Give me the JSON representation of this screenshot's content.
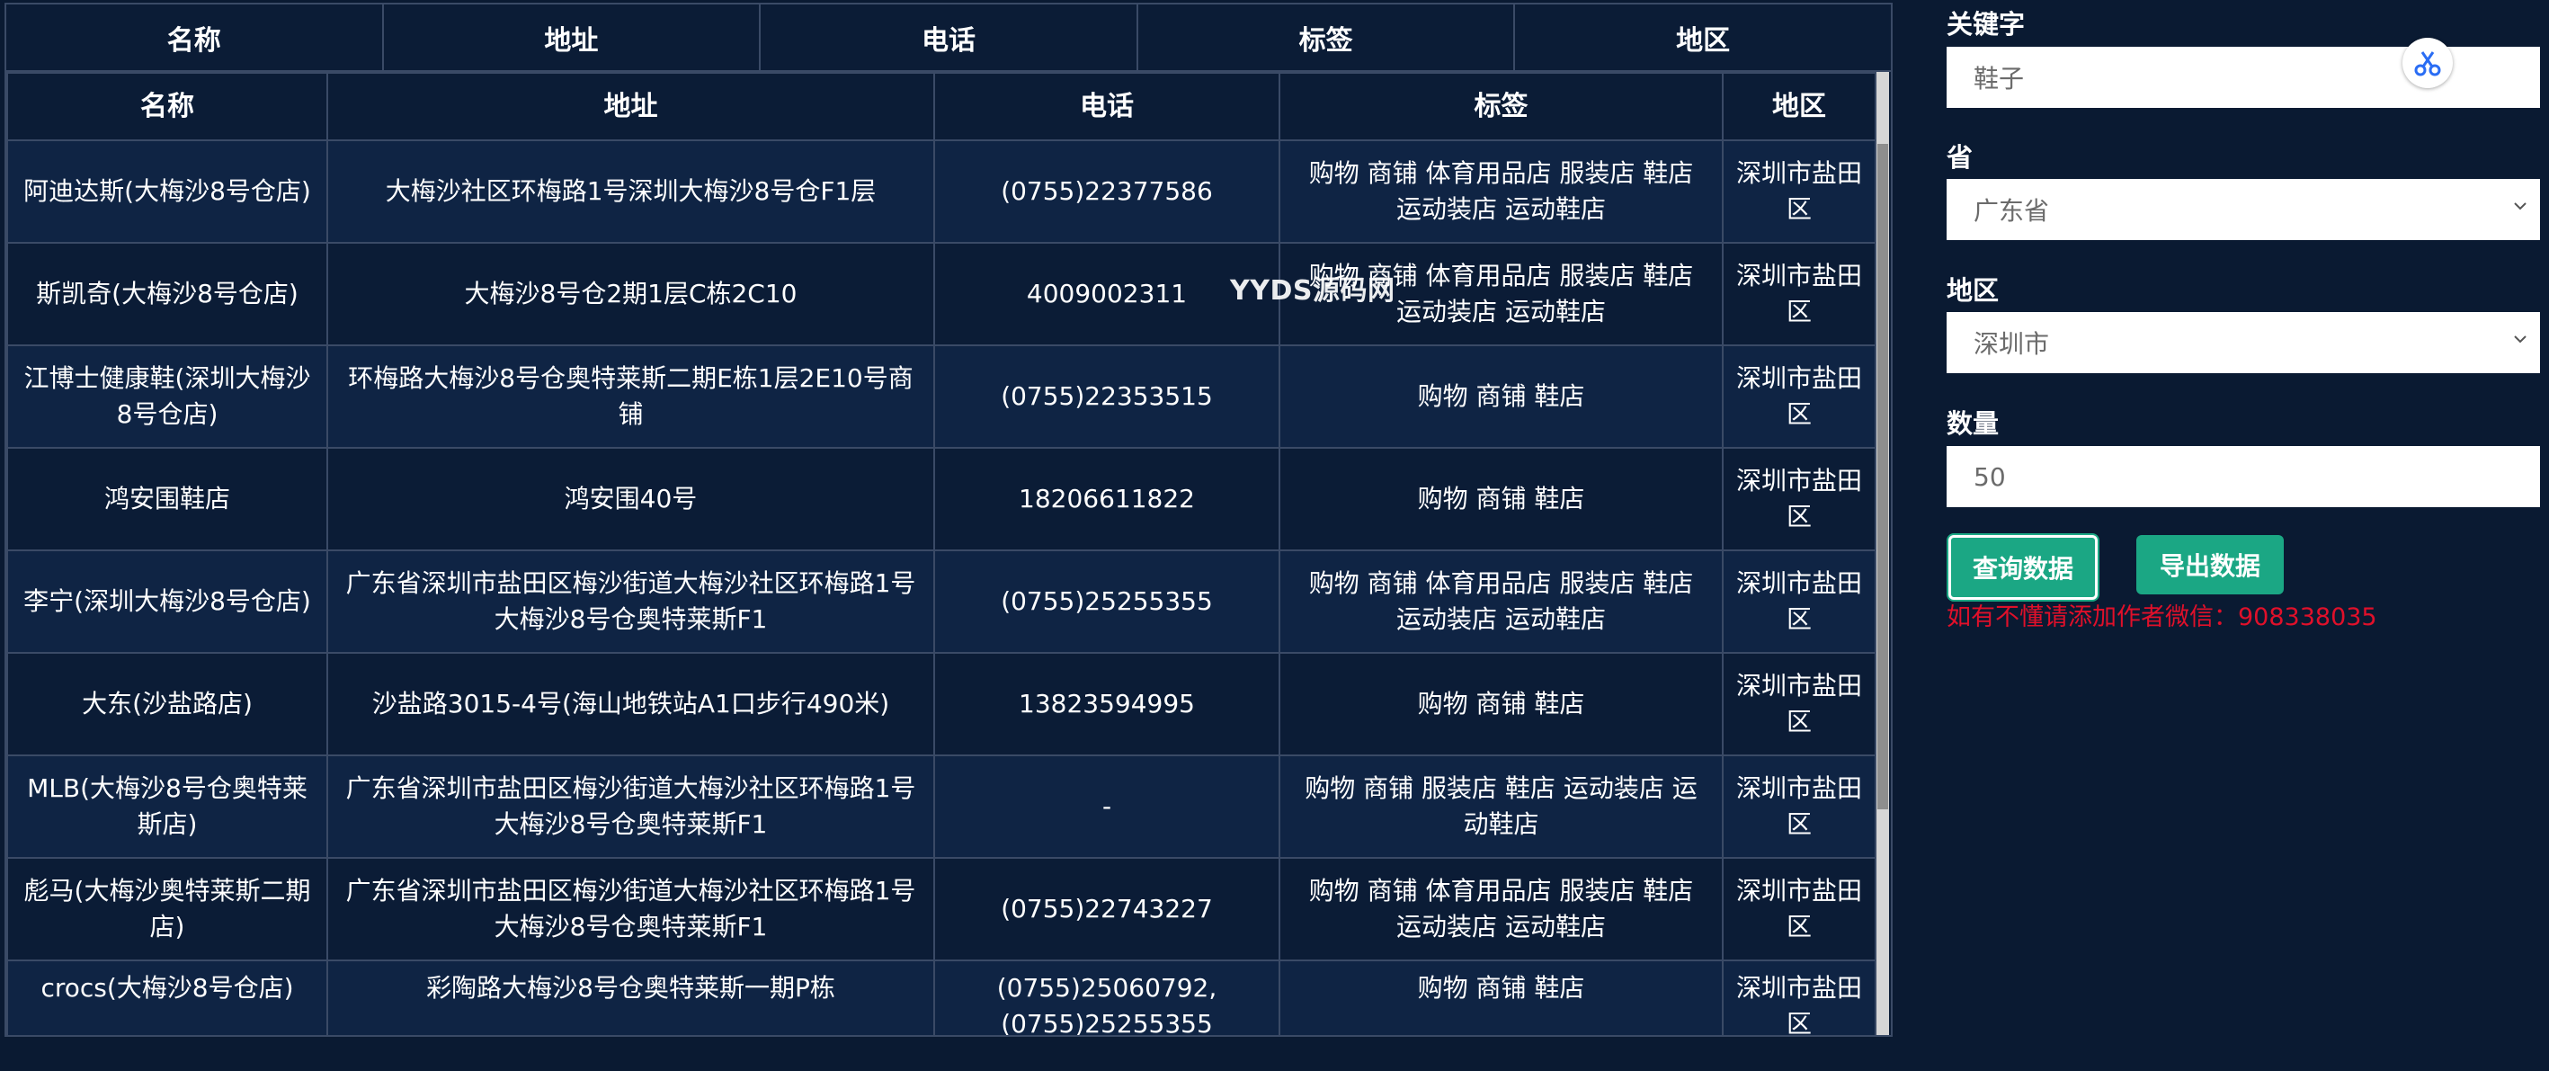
{
  "sticky_header": [
    "名称",
    "地址",
    "电话",
    "标签",
    "地区"
  ],
  "table": {
    "columns": [
      "名称",
      "地址",
      "电话",
      "标签",
      "地区"
    ],
    "rows": [
      [
        "阿迪达斯(大梅沙8号仓店)",
        "大梅沙社区环梅路1号深圳大梅沙8号仓F1层",
        "(0755)22377586",
        "购物 商铺 体育用品店 服装店 鞋店 运动装店 运动鞋店",
        "深圳市盐田区"
      ],
      [
        "斯凯奇(大梅沙8号仓店)",
        "大梅沙8号仓2期1层C栋2C10",
        "4009002311",
        "购物 商铺 体育用品店 服装店 鞋店 运动装店 运动鞋店",
        "深圳市盐田区"
      ],
      [
        "江博士健康鞋(深圳大梅沙8号仓店)",
        "环梅路大梅沙8号仓奥特莱斯二期E栋1层2E10号商铺",
        "(0755)22353515",
        "购物 商铺 鞋店",
        "深圳市盐田区"
      ],
      [
        "鸿安围鞋店",
        "鸿安围40号",
        "18206611822",
        "购物 商铺 鞋店",
        "深圳市盐田区"
      ],
      [
        "李宁(深圳大梅沙8号仓店)",
        "广东省深圳市盐田区梅沙街道大梅沙社区环梅路1号大梅沙8号仓奥特莱斯F1",
        "(0755)25255355",
        "购物 商铺 体育用品店 服装店 鞋店 运动装店 运动鞋店",
        "深圳市盐田区"
      ],
      [
        "大东(沙盐路店)",
        "沙盐路3015-4号(海山地铁站A1口步行490米)",
        "13823594995",
        "购物 商铺 鞋店",
        "深圳市盐田区"
      ],
      [
        "MLB(大梅沙8号仓奥特莱斯店)",
        "广东省深圳市盐田区梅沙街道大梅沙社区环梅路1号大梅沙8号仓奥特莱斯F1",
        "-",
        "购物 商铺 服装店 鞋店 运动装店 运动鞋店",
        "深圳市盐田区"
      ],
      [
        "彪马(大梅沙奥特莱斯二期店)",
        "广东省深圳市盐田区梅沙街道大梅沙社区环梅路1号大梅沙8号仓奥特莱斯F1",
        "(0755)22743227",
        "购物 商铺 体育用品店 服装店 鞋店 运动装店 运动鞋店",
        "深圳市盐田区"
      ],
      [
        "crocs(大梅沙8号仓店)",
        "彩陶路大梅沙8号仓奥特莱斯一期P栋",
        "(0755)25060792,(0755)25255355",
        "购物 商铺 鞋店",
        "深圳市盐田区"
      ]
    ]
  },
  "watermark": "YYDS源码网",
  "form": {
    "keyword_label": "关键字",
    "keyword_value": "鞋子",
    "province_label": "省",
    "province_value": "广东省",
    "region_label": "地区",
    "region_value": "深圳市",
    "count_label": "数量",
    "count_value": "50",
    "query_button": "查询数据",
    "export_button": "导出数据",
    "note": "如有不懂请添加作者微信：908338035"
  },
  "icons": {
    "cut_button": "scissors-icon",
    "select_arrow": "chevron-down-icon"
  },
  "colors": {
    "background": "#0a1a32",
    "button": "#1ba784",
    "note": "#e0102a"
  }
}
